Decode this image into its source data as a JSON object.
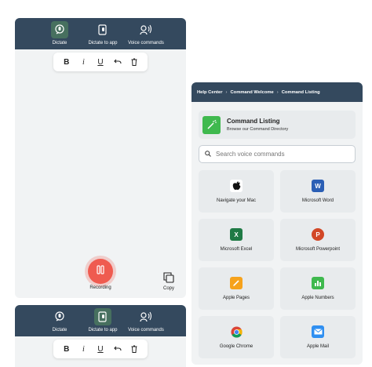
{
  "dictation_panel": {
    "tabs": [
      {
        "label": "Dictate",
        "icon": "microphone-icon"
      },
      {
        "label": "Dictate to app",
        "icon": "app-dictate-icon"
      },
      {
        "label": "Voice commands",
        "icon": "voice-commands-icon"
      }
    ],
    "toolbar": {
      "bold": "B",
      "italic": "i",
      "underline": "U",
      "undo": "undo-icon",
      "delete": "trash-icon"
    },
    "record_label": "Recording",
    "copy_label": "Copy"
  },
  "dictation_panel_2": {
    "tabs": [
      {
        "label": "Dictate",
        "icon": "microphone-icon"
      },
      {
        "label": "Dictate to app",
        "icon": "app-dictate-icon"
      },
      {
        "label": "Voice commands",
        "icon": "voice-commands-icon"
      }
    ],
    "toolbar": {
      "bold": "B",
      "italic": "i",
      "underline": "U"
    }
  },
  "commands_panel": {
    "breadcrumbs": [
      "Help Center",
      "Command Welcome",
      "Command Listing"
    ],
    "header": {
      "title": "Command Listing",
      "subtitle": "Browse our Command Directory"
    },
    "search": {
      "placeholder": "Search voice commands"
    },
    "apps": [
      {
        "name": "Navigate your Mac",
        "icon": "apple-logo-icon"
      },
      {
        "name": "Microsoft Word",
        "icon": "word-icon"
      },
      {
        "name": "Microsoft Excel",
        "icon": "excel-icon"
      },
      {
        "name": "Microsoft Powerpoint",
        "icon": "powerpoint-icon"
      },
      {
        "name": "Apple Pages",
        "icon": "pages-icon"
      },
      {
        "name": "Apple Numbers",
        "icon": "numbers-icon"
      },
      {
        "name": "Google Chrome",
        "icon": "chrome-icon"
      },
      {
        "name": "Apple Mail",
        "icon": "mail-icon"
      }
    ]
  },
  "colors": {
    "header": "#34495e",
    "active_tab": "#47705f",
    "record": "#ef5b50",
    "accent_green": "#3fb94e"
  }
}
